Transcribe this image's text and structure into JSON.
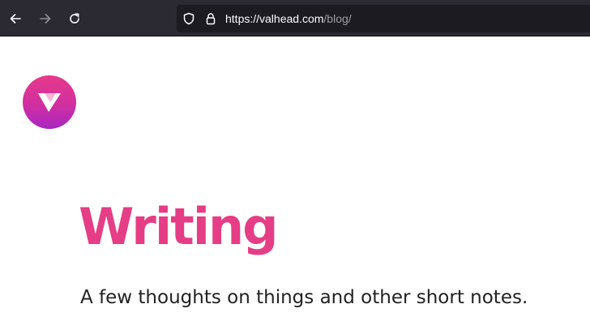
{
  "browser": {
    "url_host": "https://valhead.com",
    "url_path": "/blog/",
    "icons": [
      "back-arrow-icon",
      "forward-arrow-icon",
      "reload-icon",
      "shield-icon",
      "lock-icon"
    ],
    "colors": {
      "toolbar_bg": "#2b2a33",
      "urlbar_bg": "#1c1b22",
      "url_text": "#fbfbfe",
      "url_path_text": "#9e9ea6"
    }
  },
  "page": {
    "logo_icon": "valhead-v-logo",
    "title": "Writing",
    "subtitle": "A few thoughts on things and other short notes.",
    "colors": {
      "accent": "#e53d86",
      "logo_gradient_top": "#e63a8a",
      "logo_gradient_bottom": "#a826c2",
      "body_text": "#222222"
    }
  }
}
